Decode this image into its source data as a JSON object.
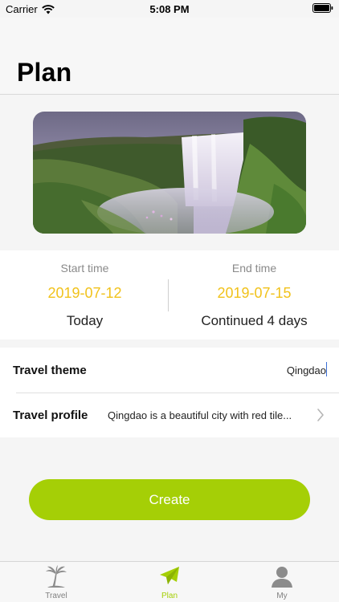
{
  "status_bar": {
    "carrier": "Carrier",
    "time": "5:08 PM"
  },
  "header": {
    "title": "Plan"
  },
  "hero": {
    "description_icon": "waterfall-photo"
  },
  "dates": {
    "start": {
      "label": "Start time",
      "value": "2019-07-12",
      "sub": "Today"
    },
    "end": {
      "label": "End time",
      "value": "2019-07-15",
      "sub": "Continued 4 days"
    }
  },
  "form": {
    "theme": {
      "label": "Travel theme",
      "value": "Qingdao"
    },
    "profile": {
      "label": "Travel profile",
      "value": "Qingdao is a beautiful city with red tile..."
    }
  },
  "create_button": {
    "label": "Create"
  },
  "tabs": [
    {
      "label": "Travel",
      "icon": "palm-tree-icon",
      "active": false
    },
    {
      "label": "Plan",
      "icon": "paper-plane-icon",
      "active": true
    },
    {
      "label": "My",
      "icon": "person-icon",
      "active": false
    }
  ],
  "colors": {
    "accent": "#a5cf06",
    "date_value": "#f1c21b",
    "inactive_tab": "#808080"
  }
}
